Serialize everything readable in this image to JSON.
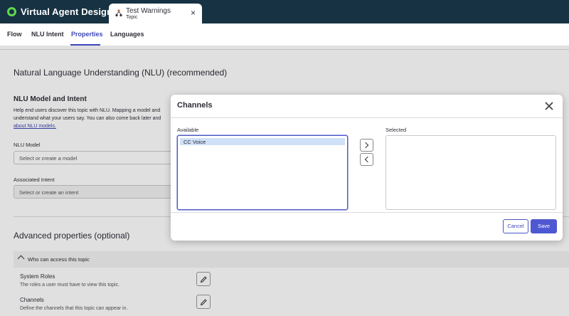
{
  "app": {
    "title": "Virtual Agent Designer",
    "logo_icon": "ring-logo-icon",
    "accent": "#62d84e"
  },
  "doc_tab": {
    "title": "Test Warnings",
    "subtitle": "Topic",
    "close": "×"
  },
  "subtabs": [
    {
      "label": "Flow",
      "active": false
    },
    {
      "label": "NLU Intent",
      "active": false
    },
    {
      "label": "Properties",
      "active": true
    },
    {
      "label": "Languages",
      "active": false
    }
  ],
  "page": {
    "section_title": "Natural Language Understanding (NLU) (recommended)",
    "nlu_heading": "NLU Model and Intent",
    "help_lines": [
      "Help end users discover this topic with NLU. Mapping a model and",
      "understand what your users say. You can also come back later and"
    ],
    "help_link": "about NLU models.",
    "model_label": "NLU Model",
    "model_placeholder": "Select or create a model",
    "intent_label": "Associated Intent",
    "intent_placeholder": "Select or create an intent",
    "advanced_title": "Advanced properties (optional)",
    "access_section": "Who can access this topic",
    "system_roles_title": "System Roles",
    "system_roles_desc": "The roles a user must have to view this topic.",
    "channels_title": "Channels",
    "channels_desc": "Define the channels that this topic can appear in."
  },
  "modal": {
    "title": "Channels",
    "available_label": "Available",
    "selected_label": "Selected",
    "available_items": [
      {
        "label": "CC Voice",
        "selected": true
      }
    ],
    "selected_items": [],
    "move_right": "move-right",
    "move_left": "move-left",
    "cancel_label": "Cancel",
    "save_label": "Save",
    "primary_color": "#4f58d3"
  }
}
